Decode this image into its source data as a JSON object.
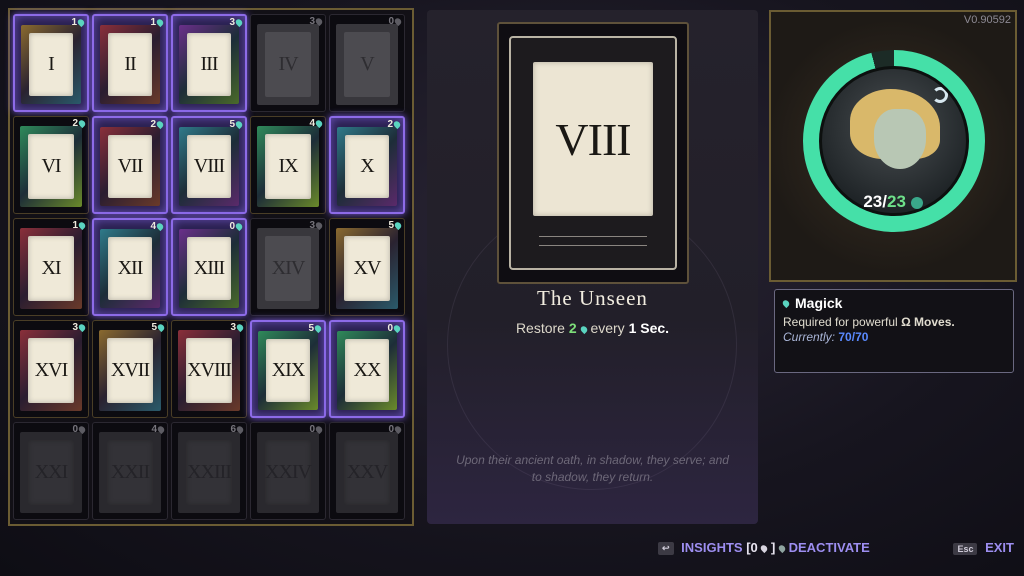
{
  "grid": {
    "cards": [
      {
        "numeral": "I",
        "cost": "1",
        "state": "active",
        "color": "gold"
      },
      {
        "numeral": "II",
        "cost": "1",
        "state": "active",
        "color": "red"
      },
      {
        "numeral": "III",
        "cost": "3",
        "state": "active",
        "color": "purple"
      },
      {
        "numeral": "IV",
        "cost": "3",
        "state": "locked",
        "color": "gray"
      },
      {
        "numeral": "V",
        "cost": "0",
        "state": "locked",
        "color": "gray"
      },
      {
        "numeral": "VI",
        "cost": "2",
        "state": "owned",
        "color": "green"
      },
      {
        "numeral": "VII",
        "cost": "2",
        "state": "active",
        "color": "red"
      },
      {
        "numeral": "VIII",
        "cost": "5",
        "state": "active",
        "color": "teal"
      },
      {
        "numeral": "IX",
        "cost": "4",
        "state": "owned",
        "color": "green"
      },
      {
        "numeral": "X",
        "cost": "2",
        "state": "active",
        "color": "teal"
      },
      {
        "numeral": "XI",
        "cost": "1",
        "state": "owned",
        "color": "red"
      },
      {
        "numeral": "XII",
        "cost": "4",
        "state": "active",
        "color": "teal"
      },
      {
        "numeral": "XIII",
        "cost": "0",
        "state": "active",
        "color": "purple"
      },
      {
        "numeral": "XIV",
        "cost": "3",
        "state": "locked",
        "color": "gray"
      },
      {
        "numeral": "XV",
        "cost": "5",
        "state": "owned",
        "color": "gold"
      },
      {
        "numeral": "XVI",
        "cost": "3",
        "state": "owned",
        "color": "red"
      },
      {
        "numeral": "XVII",
        "cost": "5",
        "state": "owned",
        "color": "gold"
      },
      {
        "numeral": "XVIII",
        "cost": "3",
        "state": "owned",
        "color": "red"
      },
      {
        "numeral": "XIX",
        "cost": "5",
        "state": "active",
        "color": "green"
      },
      {
        "numeral": "XX",
        "cost": "0",
        "state": "active",
        "color": "green"
      },
      {
        "numeral": "XXI",
        "cost": "0",
        "state": "empty",
        "color": "gray"
      },
      {
        "numeral": "XXII",
        "cost": "4",
        "state": "empty",
        "color": "gray"
      },
      {
        "numeral": "XXIII",
        "cost": "6",
        "state": "empty",
        "color": "gray"
      },
      {
        "numeral": "XXIV",
        "cost": "0",
        "state": "empty",
        "color": "gray"
      },
      {
        "numeral": "XXV",
        "cost": "0",
        "state": "empty",
        "color": "gray"
      }
    ]
  },
  "detail": {
    "card_numeral": "VIII",
    "card_title": "The Unseen",
    "effect_prefix": "Restore",
    "effect_value": "2",
    "effect_middle": "every",
    "effect_time": "1 Sec.",
    "flavor_line1": "Upon their ancient oath, in shadow, they serve; and",
    "flavor_line2": "to shadow, they return."
  },
  "portrait": {
    "version": "V0.90592",
    "health_current": "23",
    "health_max": "23",
    "ring_fill_fraction": 0.96,
    "ring_color": "#45e0a8"
  },
  "tooltip": {
    "title": "Magick",
    "line_prefix": "Required for powerful",
    "line_symbol": "Ω",
    "line_suffix": "Moves.",
    "current_label": "Currently:",
    "current_value": "70",
    "current_max": "70"
  },
  "footer": {
    "insights_label": "INSIGHTS",
    "insights_count": "[0",
    "insights_close": "]",
    "deactivate_label": "DEACTIVATE",
    "exit_label": "EXIT",
    "insights_key": "↩",
    "exit_key": "Esc"
  }
}
